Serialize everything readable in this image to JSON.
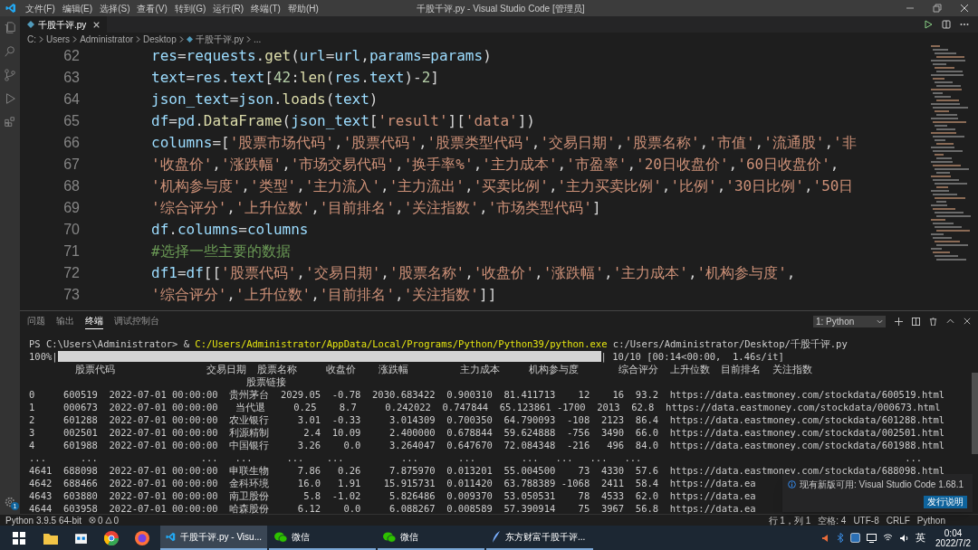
{
  "window": {
    "title": "千股千评.py - Visual Studio Code [管理员]"
  },
  "menu": [
    "文件(F)",
    "编辑(E)",
    "选择(S)",
    "查看(V)",
    "转到(G)",
    "运行(R)",
    "终端(T)",
    "帮助(H)"
  ],
  "settings_badge": "1",
  "tabs": [
    {
      "label": "千股千评.py",
      "selected": true
    }
  ],
  "breadcrumbs": [
    "C:",
    "Users",
    "Administrator",
    "Desktop",
    "千股千评.py",
    "..."
  ],
  "editor": {
    "lines": [
      {
        "number": "62",
        "code": "res=requests.get(url=url,params=params)"
      },
      {
        "number": "63",
        "code": "text=res.text[42:len(res.text)-2]"
      },
      {
        "number": "64",
        "code": "json_text=json.loads(text)"
      },
      {
        "number": "65",
        "code": "df=pd.DataFrame(json_text['result']['data'])"
      },
      {
        "number": "66",
        "code": "columns=['股票市场代码','股票代码','股票类型代码','交易日期','股票名称','市值','流通股','非"
      },
      {
        "number": "67",
        "code": "'收盘价','涨跌幅','市场交易代码','换手率%','主力成本','市盈率','20日收盘价','60日收盘价',"
      },
      {
        "number": "68",
        "code": "'机构参与度','类型','主力流入','主力流出','买卖比例','主力买卖比例','比例','30日比例','50日"
      },
      {
        "number": "69",
        "code": "'综合评分','上升位数','目前排名','关注指数','市场类型代码']"
      },
      {
        "number": "70",
        "code": "df.columns=columns"
      },
      {
        "number": "71",
        "code": "#选择一些主要的数据"
      },
      {
        "number": "72",
        "code": "df1=df[['股票代码','交易日期','股票名称','收盘价','涨跌幅','主力成本','机构参与度',"
      },
      {
        "number": "73",
        "code": "'综合评分','上升位数','目前排名','关注指数']]"
      }
    ]
  },
  "panel": {
    "tabs": [
      {
        "label": "问题",
        "selected": false
      },
      {
        "label": "输出",
        "selected": false
      },
      {
        "label": "终端",
        "selected": true
      },
      {
        "label": "调试控制台",
        "selected": false
      }
    ],
    "terminal_selector": "1: Python",
    "terminal": [
      {
        "kind": "command",
        "prompt": "PS C:\\Users\\Administrator> & ",
        "path": "C:/Users/Administrator/AppData/Local/Programs/Python/Python39/python.exe",
        "args": " c:/Users/Administrator/Desktop/千股千评.py"
      },
      {
        "kind": "progress",
        "label": "100%|",
        "suffix": "| 10/10 [00:14<00:00,  1.46s/it]"
      },
      {
        "kind": "text",
        "text": "        股票代码                交易日期  股票名称     收盘价    涨跌幅         主力成本     机构参与度       综合评分  上升位数  目前排名  关注指数"
      },
      {
        "kind": "text",
        "text": "                                      股票链接"
      },
      {
        "kind": "text",
        "text": "0     600519  2022-07-01 00:00:00  贵州茅台  2029.05  -0.78  2030.683422  0.900310  81.411713    12    16  93.2  https://data.eastmoney.com/stockdata/600519.html"
      },
      {
        "kind": "text",
        "text": "1     000673  2022-07-01 00:00:00   当代退     0.25    8.7     0.242022  0.747844  65.123861 -1700  2013  62.8  https://data.eastmoney.com/stockdata/000673.html"
      },
      {
        "kind": "text",
        "text": "2     601288  2022-07-01 00:00:00  农业银行     3.01  -0.33     3.014309  0.700350  64.790093  -108  2123  86.4  https://data.eastmoney.com/stockdata/601288.html"
      },
      {
        "kind": "text",
        "text": "3     002501  2022-07-01 00:00:00  利源精制      2.4  10.09     2.400000  0.678844  59.624888  -756  3490  66.0  https://data.eastmoney.com/stockdata/002501.html"
      },
      {
        "kind": "text",
        "text": "4     601988  2022-07-01 00:00:00  中国银行     3.26    0.0     3.264047  0.647670  72.084348  -216   496  84.0  https://data.eastmoney.com/stockdata/601988.html"
      },
      {
        "kind": "text",
        "text": "...      ...                  ...   ...      ...    ...          ...       ...        ...   ...   ...   ...                                              ..."
      },
      {
        "kind": "text",
        "text": "4641  688098  2022-07-01 00:00:00  申联生物     7.86   0.26     7.875970  0.013201  55.004500    73  4330  57.6  https://data.eastmoney.com/stockdata/688098.html"
      },
      {
        "kind": "text",
        "text": "4642  688466  2022-07-01 00:00:00  金科环境     16.0   1.91    15.915731  0.011420  63.788389 -1068  2411  58.4  https://data.ea"
      },
      {
        "kind": "text",
        "text": "4643  603880  2022-07-01 00:00:00  南卫股份      5.8  -1.02     5.826486  0.009370  53.050531    78  4533  62.0  https://data.ea"
      },
      {
        "kind": "text",
        "text": "4644  603958  2022-07-01 00:00:00  哈森股份     6.12    0.0     6.088267  0.008589  57.390914    75  3967  56.8  https://data.ea"
      }
    ]
  },
  "notification": {
    "message": "现有新版可用: Visual Studio Code 1.68.1",
    "buttons": [
      "发行说明"
    ]
  },
  "status_bar": {
    "interpreter": "Python 3.9.5 64-bit",
    "errors": "0",
    "warnings": "0",
    "right": [
      "行 1，列 1",
      "空格: 4",
      "UTF-8",
      "CRLF",
      "Python"
    ]
  },
  "taskbar": {
    "apps": [
      {
        "kind": "vscode",
        "label": "千股千评.py - Visu...",
        "selected": true
      },
      {
        "kind": "wechat",
        "label": "微信",
        "selected": false
      },
      {
        "kind": "wechat",
        "label": "微信",
        "selected": false
      },
      {
        "kind": "quill",
        "label": "东方财富千股千评...",
        "selected": false
      }
    ],
    "ime": "英",
    "time": "0:04",
    "date": "2022/7/2"
  }
}
